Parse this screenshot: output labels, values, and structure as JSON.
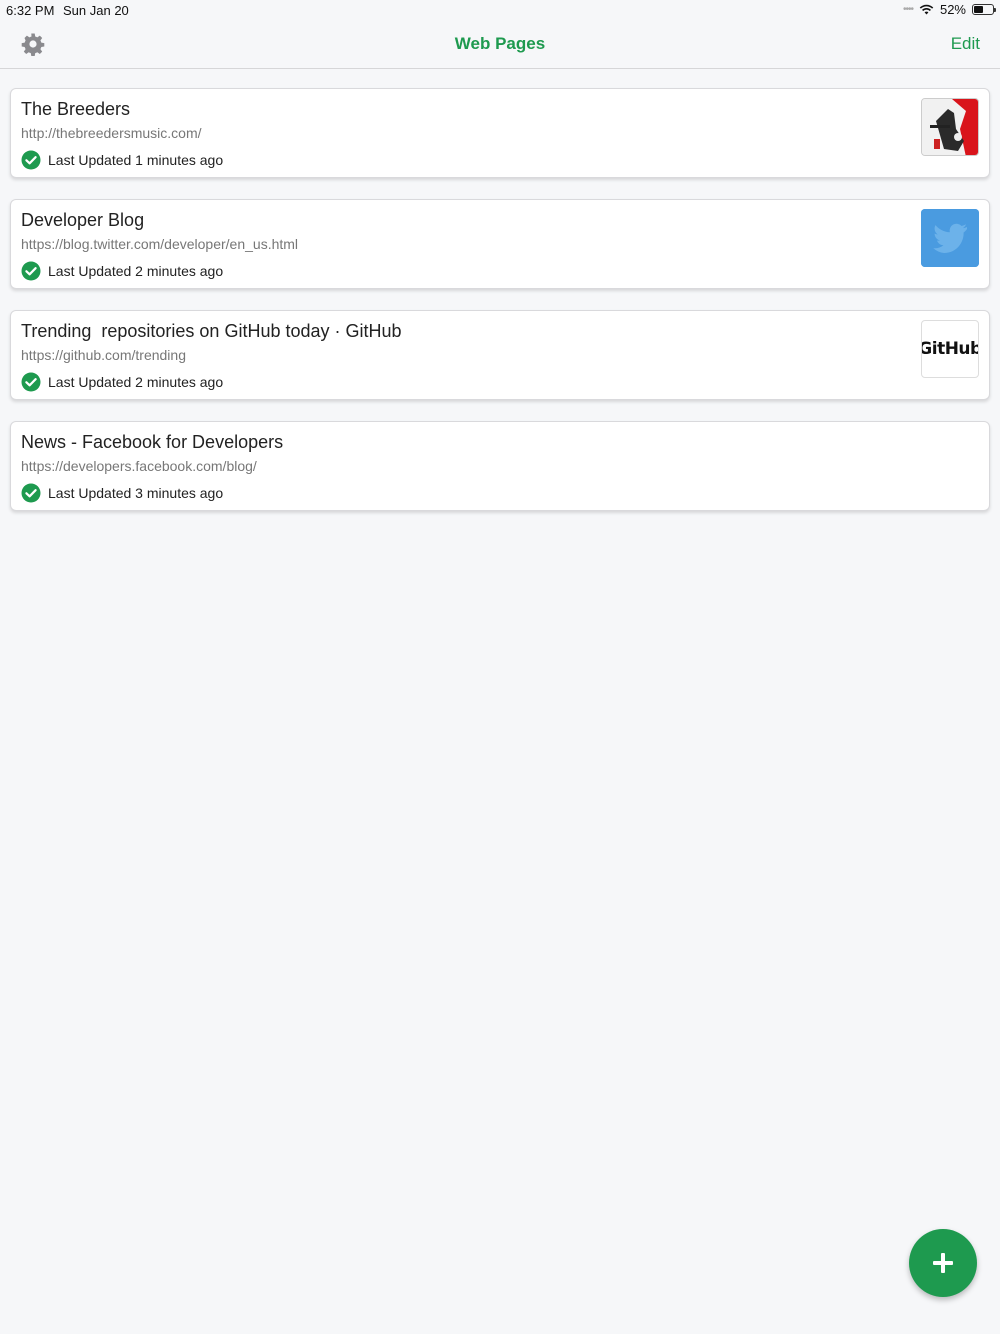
{
  "status_bar": {
    "time": "6:32 PM",
    "date": "Sun Jan 20",
    "battery": "52%",
    "battery_level": 0.52,
    "signal_icon": "signal-dots-icon",
    "wifi_icon": "wifi-icon"
  },
  "nav": {
    "title": "Web Pages",
    "edit_label": "Edit",
    "settings_icon": "gear-icon"
  },
  "colors": {
    "accent": "#1e9a4f",
    "background": "#f6f7f9"
  },
  "pages": [
    {
      "title": "The Breeders",
      "url": "http://thebreedersmusic.com/",
      "status": "Last Updated 1 minutes ago",
      "thumbnail": "breeders-thumbnail"
    },
    {
      "title": "Developer Blog",
      "url": "https://blog.twitter.com/developer/en_us.html",
      "status": "Last Updated 2 minutes ago",
      "thumbnail": "twitter-thumbnail"
    },
    {
      "title": "Trending  repositories on GitHub today · GitHub",
      "url": "https://github.com/trending",
      "status": "Last Updated 2 minutes ago",
      "thumbnail": "github-thumbnail",
      "thumbnail_text": "GitHub"
    },
    {
      "title": "News - Facebook for Developers",
      "url": "https://developers.facebook.com/blog/",
      "status": "Last Updated 3 minutes ago",
      "thumbnail": null
    }
  ],
  "fab": {
    "icon": "plus-icon"
  }
}
